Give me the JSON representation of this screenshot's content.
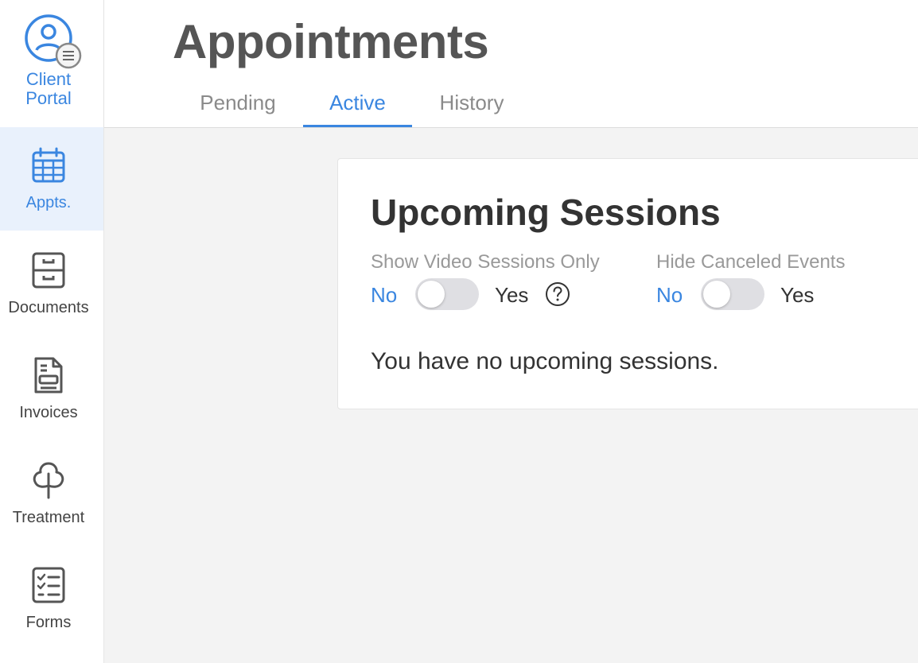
{
  "portal": {
    "label_line1": "Client",
    "label_line2": "Portal",
    "icon": "user-circle-menu-icon"
  },
  "sidebar": {
    "items": [
      {
        "label": "Appts.",
        "icon": "calendar-icon",
        "active": true
      },
      {
        "label": "Documents",
        "icon": "file-cabinet-icon",
        "active": false
      },
      {
        "label": "Invoices",
        "icon": "invoice-icon",
        "active": false
      },
      {
        "label": "Treatment",
        "icon": "tree-icon",
        "active": false
      },
      {
        "label": "Forms",
        "icon": "checklist-icon",
        "active": false
      }
    ]
  },
  "header": {
    "title": "Appointments",
    "tabs": [
      {
        "label": "Pending",
        "active": false
      },
      {
        "label": "Active",
        "active": true
      },
      {
        "label": "History",
        "active": false
      }
    ]
  },
  "card": {
    "title": "Upcoming Sessions",
    "filters": [
      {
        "label": "Show Video Sessions Only",
        "no": "No",
        "yes": "Yes",
        "value": "No"
      },
      {
        "label": "Hide Canceled Events",
        "no": "No",
        "yes": "Yes",
        "value": "No"
      }
    ],
    "empty_message": "You have no upcoming sessions."
  },
  "colors": {
    "accent": "#3a86e0",
    "title": "#555555",
    "muted": "#999999",
    "background": "#f3f3f3"
  }
}
